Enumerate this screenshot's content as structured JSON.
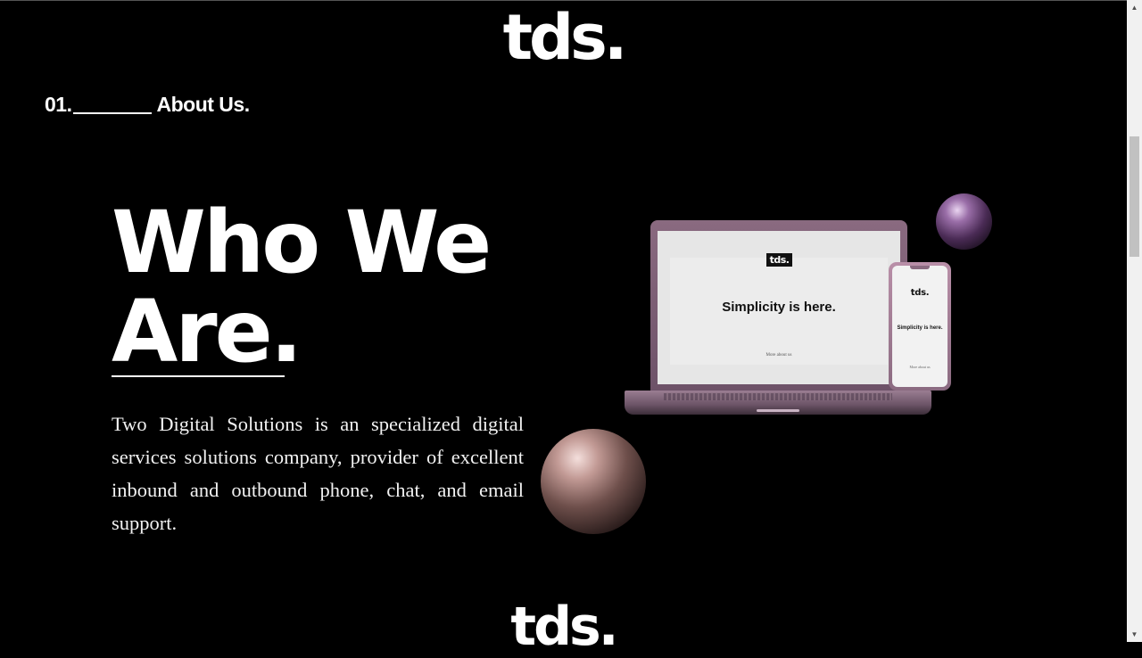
{
  "header": {
    "logo": "tds."
  },
  "section": {
    "number": "01.",
    "label": "About Us."
  },
  "hero": {
    "headline_line1": "Who We",
    "headline_line2": "Are.",
    "description": "Two Digital Solutions is an specialized digital services solutions company, provider of excellent inbound and outbound phone, chat, and email support."
  },
  "mockup": {
    "laptop_logo": "tds.",
    "laptop_tagline": "Simplicity is here.",
    "laptop_link": "More about us",
    "phone_logo": "tds.",
    "phone_tagline": "Simplicity is here.",
    "phone_link": "More about us"
  },
  "footer": {
    "logo": "tds."
  },
  "scrollbar": {
    "up_icon": "▲",
    "down_icon": "▼"
  },
  "colors": {
    "background": "#000000",
    "text": "#ffffff",
    "device_accent": "#8a6a80"
  }
}
